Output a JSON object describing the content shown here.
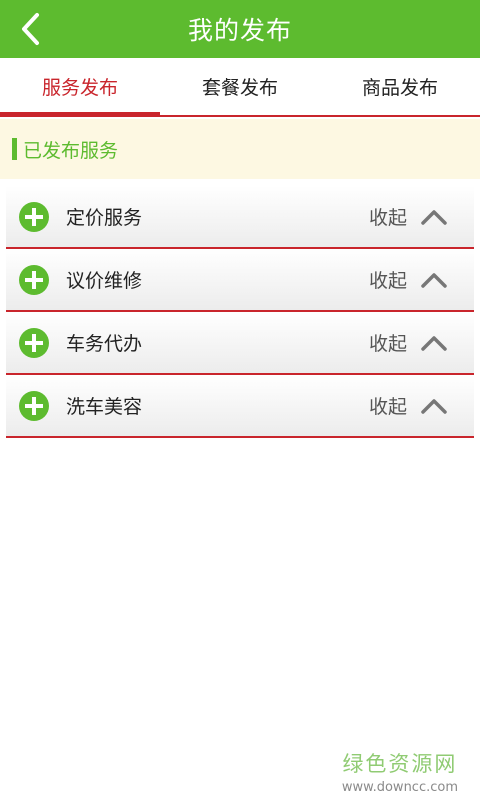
{
  "header": {
    "title": "我的发布",
    "back_icon": "chevron-left-icon"
  },
  "tabs": [
    {
      "label": "服务发布",
      "active": true
    },
    {
      "label": "套餐发布",
      "active": false
    },
    {
      "label": "商品发布",
      "active": false
    }
  ],
  "section": {
    "label": "已发布服务"
  },
  "items": [
    {
      "label": "定价服务",
      "action": "收起",
      "icon": "plus-circle-icon",
      "chevron": "chevron-up-icon"
    },
    {
      "label": "议价维修",
      "action": "收起",
      "icon": "plus-circle-icon",
      "chevron": "chevron-up-icon"
    },
    {
      "label": "车务代办",
      "action": "收起",
      "icon": "plus-circle-icon",
      "chevron": "chevron-up-icon"
    },
    {
      "label": "洗车美容",
      "action": "收起",
      "icon": "plus-circle-icon",
      "chevron": "chevron-up-icon"
    }
  ],
  "watermark": {
    "text": "绿色资源网",
    "url": "www.downcc.com"
  },
  "colors": {
    "brand_green": "#5dbb2f",
    "accent_red": "#c9252c",
    "section_bg": "#fdf8e2"
  }
}
